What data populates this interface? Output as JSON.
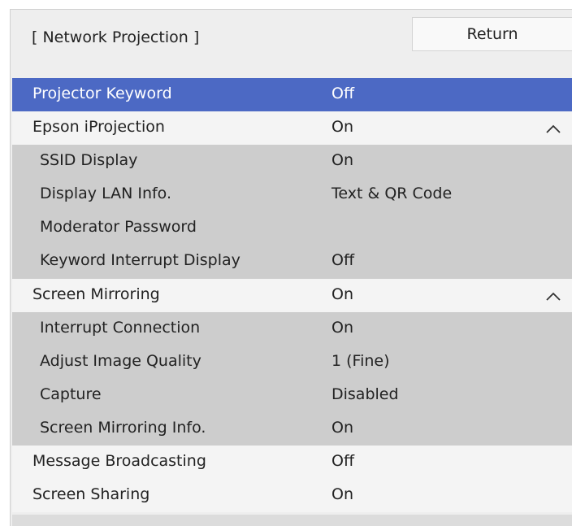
{
  "header": {
    "title": "[ Network Projection ]",
    "return_label": "Return"
  },
  "menu": {
    "items": [
      {
        "label": "Projector Keyword",
        "value": "Off",
        "type": "main",
        "selected": true,
        "expandable": false
      },
      {
        "label": "Epson iProjection",
        "value": "On",
        "type": "main",
        "selected": false,
        "expandable": true,
        "expanded": true,
        "icon": "chevron-up-icon"
      },
      {
        "label": "SSID Display",
        "value": "On",
        "type": "sub"
      },
      {
        "label": "Display LAN Info.",
        "value": "Text & QR Code",
        "type": "sub"
      },
      {
        "label": "Moderator Password",
        "value": "",
        "type": "sub"
      },
      {
        "label": "Keyword Interrupt Display",
        "value": "Off",
        "type": "sub"
      },
      {
        "label": "Screen Mirroring",
        "value": "On",
        "type": "main",
        "selected": false,
        "expandable": true,
        "expanded": true,
        "icon": "chevron-up-icon"
      },
      {
        "label": "Interrupt Connection",
        "value": "On",
        "type": "sub"
      },
      {
        "label": "Adjust Image Quality",
        "value": "1 (Fine)",
        "type": "sub"
      },
      {
        "label": "Capture",
        "value": "Disabled",
        "type": "sub"
      },
      {
        "label": "Screen Mirroring Info.",
        "value": "On",
        "type": "sub"
      },
      {
        "label": "Message Broadcasting",
        "value": "Off",
        "type": "main",
        "selected": false,
        "expandable": false
      },
      {
        "label": "Screen Sharing",
        "value": "On",
        "type": "main",
        "selected": false,
        "expandable": false
      }
    ]
  },
  "colors": {
    "selected": "#4c69c4",
    "main_row": "#f4f4f4",
    "sub_row": "#cdcdcd",
    "panel": "#eeeeee"
  }
}
